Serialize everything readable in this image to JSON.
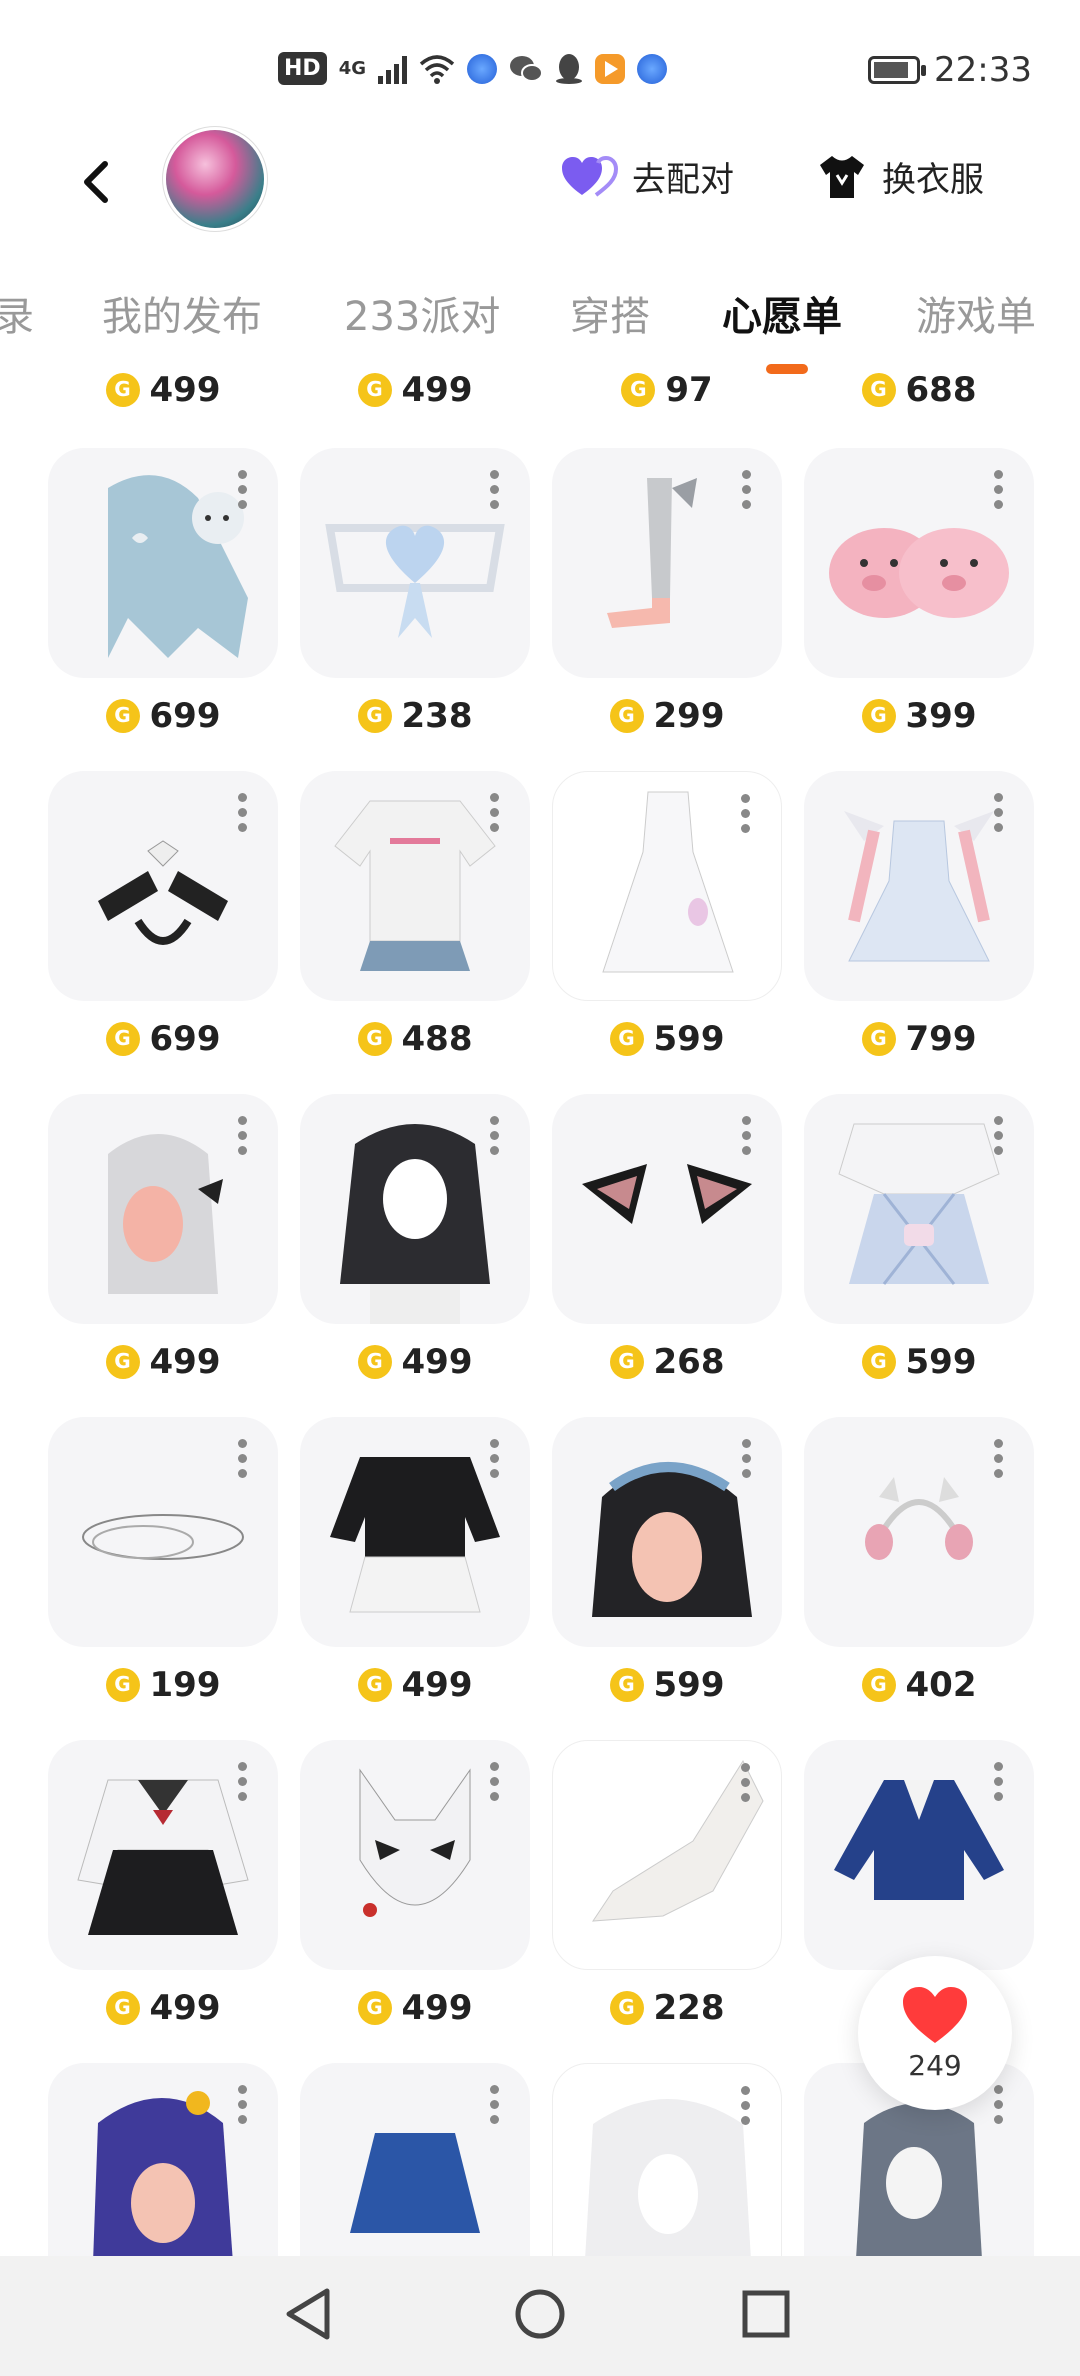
{
  "status_bar": {
    "hd": "HD",
    "network": "4G",
    "time": "22:33"
  },
  "header": {
    "match_label": "去配对",
    "dress_label": "换衣服"
  },
  "tabs": [
    {
      "label": "录"
    },
    {
      "label": "我的发布"
    },
    {
      "label": "233派对"
    },
    {
      "label": "穿搭"
    },
    {
      "label": "心愿单",
      "active": true
    },
    {
      "label": "游戏单"
    }
  ],
  "top_prices": [
    "499",
    "499",
    "97",
    "688"
  ],
  "items": [
    {
      "name": "blue-twin-tail-hair",
      "price": "699"
    },
    {
      "name": "heart-bow-accessory",
      "price": "238"
    },
    {
      "name": "ribbon-socks",
      "price": "299"
    },
    {
      "name": "pink-pig-slippers",
      "price": "399"
    },
    {
      "name": "winged-arm-sleeves",
      "price": "699"
    },
    {
      "name": "white-tshirt-skirt-outfit",
      "price": "488"
    },
    {
      "name": "white-lace-dress",
      "price": "599"
    },
    {
      "name": "winged-blue-dress",
      "price": "799"
    },
    {
      "name": "silver-ponytail-hair",
      "price": "499"
    },
    {
      "name": "black-long-hair",
      "price": "499"
    },
    {
      "name": "black-cat-ears",
      "price": "268"
    },
    {
      "name": "white-top-plaid-skirt",
      "price": "599"
    },
    {
      "name": "halo-ring-effect",
      "price": "199"
    },
    {
      "name": "black-sweater-ruffle-skirt",
      "price": "499"
    },
    {
      "name": "black-short-hair-headband",
      "price": "599"
    },
    {
      "name": "cat-ear-headphones",
      "price": "402"
    },
    {
      "name": "sailor-uniform",
      "price": "499"
    },
    {
      "name": "fox-mask",
      "price": "499"
    },
    {
      "name": "white-hand-glove",
      "price": "228"
    },
    {
      "name": "blue-blazer",
      "price": ""
    },
    {
      "name": "purple-short-hair",
      "price": ""
    },
    {
      "name": "blue-pleated-skirt",
      "price": ""
    },
    {
      "name": "white-twin-tail-hair",
      "price": ""
    },
    {
      "name": "gray-braided-hair",
      "price": ""
    }
  ],
  "like_count": "249",
  "colors": {
    "accent": "#f26a1b",
    "coin": "#f5c419",
    "heart": "#ff3b3b",
    "match_icon": "#7b5cf0"
  }
}
